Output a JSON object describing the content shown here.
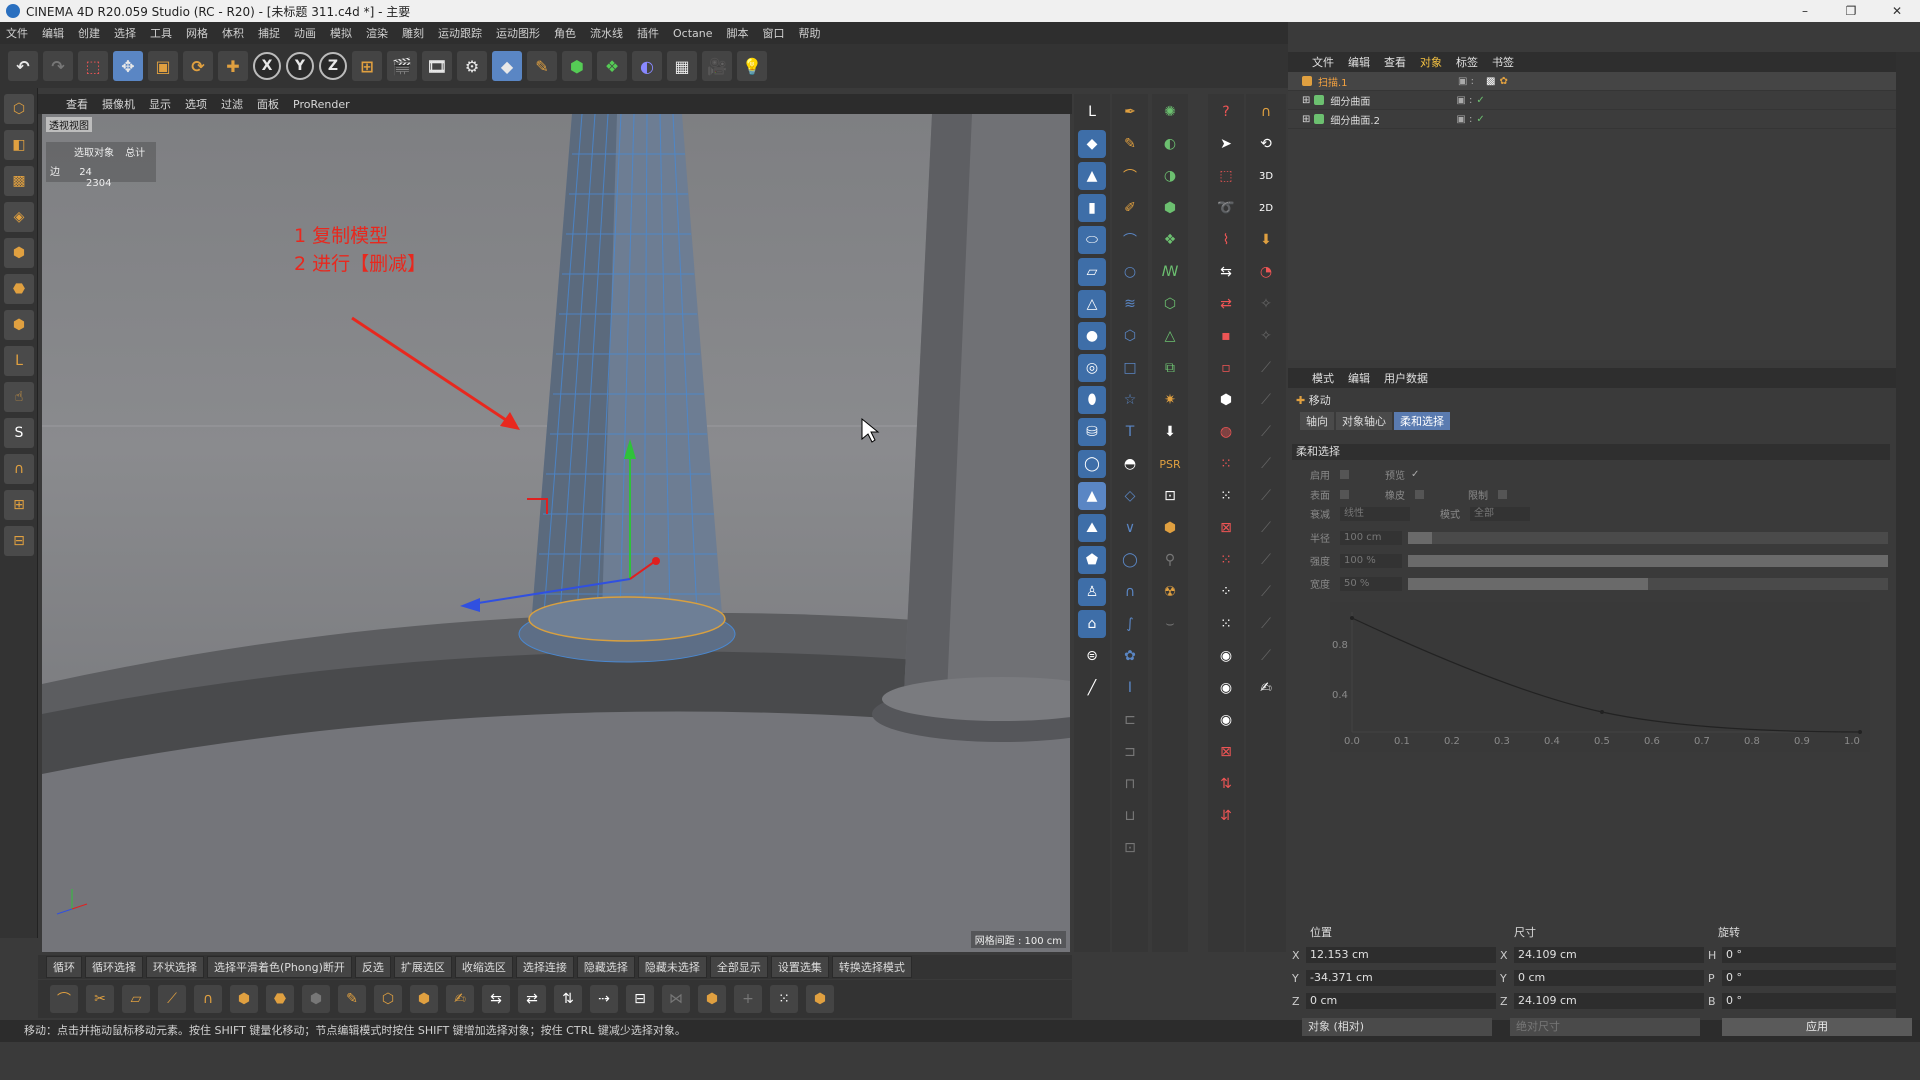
{
  "window": {
    "title": "CINEMA 4D R20.059 Studio (RC - R20) - [未标题 311.c4d *] - 主要",
    "controls": [
      "–",
      "❐",
      "✕"
    ]
  },
  "menu": [
    "文件",
    "编辑",
    "创建",
    "选择",
    "工具",
    "网格",
    "体积",
    "捕捉",
    "动画",
    "模拟",
    "渲染",
    "雕刻",
    "运动跟踪",
    "运动图形",
    "角色",
    "流水线",
    "插件",
    "Octane",
    "脚本",
    "窗口",
    "帮助"
  ],
  "main_toolbar": {
    "axis_x": "X",
    "axis_y": "Y",
    "axis_z": "Z"
  },
  "viewport": {
    "menu": [
      "查看",
      "摄像机",
      "显示",
      "选项",
      "过滤",
      "面板",
      "ProRender"
    ],
    "label": "透视视图",
    "stats_header_selected": "选取对象",
    "stats_header_total": "总计",
    "stats_row_label": "边",
    "stats_selected": "24",
    "stats_total": "2304",
    "annotation_line1": "1 复制模型",
    "annotation_line2": "2 进行【删减】",
    "grid_info": "网格间距 : 100 cm"
  },
  "selection_bar": [
    "循环",
    "循环选择",
    "环状选择",
    "选择平滑着色(Phong)断开",
    "反选",
    "扩展选区",
    "收缩选区",
    "选择连接",
    "隐藏选择",
    "隐藏未选择",
    "全部显示",
    "设置选集",
    "转换选择模式"
  ],
  "status_bar": "移动：点击并拖动鼠标移动元素。按住 SHIFT 键量化移动；节点编辑模式时按住 SHIFT 键增加选择对象；按住 CTRL 键减少选择对象。",
  "object_manager": {
    "tabs": [
      "文件",
      "编辑",
      "查看",
      "对象",
      "标签",
      "书签"
    ],
    "objects": [
      {
        "name": "扫描.1",
        "color": "#e0a040",
        "active": true
      },
      {
        "name": "细分曲面",
        "color": "#6cc070",
        "active": false
      },
      {
        "name": "细分曲面.2",
        "color": "#6cc070",
        "active": false
      }
    ]
  },
  "attribute_manager": {
    "tabs": [
      "模式",
      "编辑",
      "用户数据"
    ],
    "tool_name": "移动",
    "subtabs": [
      "轴向",
      "对象轴心",
      "柔和选择"
    ],
    "active_subtab": 2,
    "section": "柔和选择",
    "fields": {
      "enable": "启用",
      "preview": "预览",
      "surface": "表面",
      "rubber": "橡皮",
      "restrict": "限制",
      "falloff_label": "衰减",
      "falloff_value": "线性",
      "mode_label": "模式",
      "mode_value": "全部",
      "radius_label": "半径",
      "radius_value": "100 cm",
      "radius_fill": 0.05,
      "strength_label": "强度",
      "strength_value": "100 %",
      "strength_fill": 1.0,
      "width_label": "宽度",
      "width_value": "50 %",
      "width_fill": 0.5
    },
    "graph": {
      "y_ticks": [
        "0.8",
        "0.4"
      ],
      "x_ticks": [
        "0.0",
        "0.1",
        "0.2",
        "0.3",
        "0.4",
        "0.5",
        "0.6",
        "0.7",
        "0.8",
        "0.9",
        "1.0"
      ]
    }
  },
  "coordinates": {
    "headers": [
      "位置",
      "尺寸",
      "旋转"
    ],
    "rows": [
      {
        "pos_axis": "X",
        "pos": "12.153 cm",
        "size_axis": "X",
        "size": "24.109 cm",
        "rot_axis": "H",
        "rot": "0 °"
      },
      {
        "pos_axis": "Y",
        "pos": "-34.371 cm",
        "size_axis": "Y",
        "size": "0 cm",
        "rot_axis": "P",
        "rot": "0 °"
      },
      {
        "pos_axis": "Z",
        "pos": "0 cm",
        "size_axis": "Z",
        "size": "24.109 cm",
        "rot_axis": "B",
        "rot": "0 °"
      }
    ],
    "mode": "对象 (相对)",
    "size_mode": "绝对尺寸",
    "apply": "应用"
  },
  "colors": {
    "accent": "#5a86c4",
    "annotation": "#e8281e",
    "mesh_lines": "#4a88d0"
  }
}
